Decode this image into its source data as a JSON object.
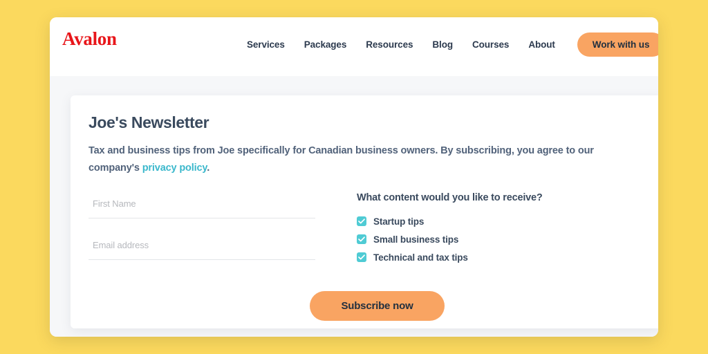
{
  "page": {
    "background_color": "#FBD95E"
  },
  "header": {
    "brand": "Avalon",
    "brand_color": "#E8161A",
    "nav_items": [
      {
        "label": "Services"
      },
      {
        "label": "Packages"
      },
      {
        "label": "Resources"
      },
      {
        "label": "Blog"
      },
      {
        "label": "Courses"
      },
      {
        "label": "About"
      }
    ],
    "cta": {
      "label": "Work with us",
      "background_color": "#F9A462",
      "text_color": "#22303F"
    }
  },
  "newsletter": {
    "title": "Joe's Newsletter",
    "description_before_link": "Tax and business tips from Joe specifically for Canadian business owners. By subscribing, you agree to our company's ",
    "link_text": "privacy policy",
    "link_color": "#3BB8CC",
    "description_after_link": ".",
    "fields": [
      {
        "name": "first-name",
        "value": "",
        "placeholder": "First Name"
      },
      {
        "name": "email",
        "value": "",
        "placeholder": "Email address"
      }
    ],
    "preferences": {
      "question": "What content would you like to receive?",
      "checkbox_color": "#4FCBD4",
      "options": [
        {
          "label": "Startup tips",
          "checked": true
        },
        {
          "label": "Small business tips",
          "checked": true
        },
        {
          "label": "Technical and tax tips",
          "checked": true
        }
      ]
    },
    "submit": {
      "label": "Subscribe now",
      "background_color": "#F9A462",
      "text_color": "#22303F"
    }
  }
}
